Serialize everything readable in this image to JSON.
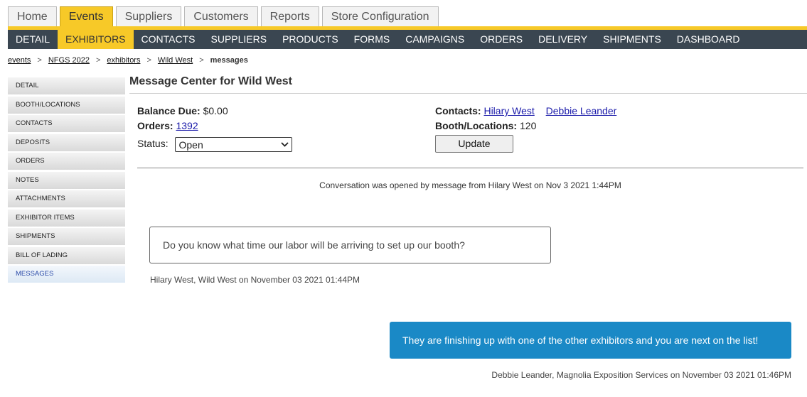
{
  "top_tabs": [
    "Home",
    "Events",
    "Suppliers",
    "Customers",
    "Reports",
    "Store Configuration"
  ],
  "subnav": [
    "DETAIL",
    "EXHIBITORS",
    "CONTACTS",
    "SUPPLIERS",
    "PRODUCTS",
    "FORMS",
    "CAMPAIGNS",
    "ORDERS",
    "DELIVERY",
    "SHIPMENTS",
    "DASHBOARD"
  ],
  "breadcrumb": {
    "events": "events",
    "event": "NFGS 2022",
    "exhibitors": "exhibitors",
    "exhibitor": "Wild West",
    "current": "messages",
    "sep": ">"
  },
  "sidebar": [
    "DETAIL",
    "BOOTH/LOCATIONS",
    "CONTACTS",
    "DEPOSITS",
    "ORDERS",
    "NOTES",
    "ATTACHMENTS",
    "EXHIBITOR ITEMS",
    "SHIPMENTS",
    "BILL OF LADING",
    "MESSAGES"
  ],
  "main": {
    "title": "Message Center for Wild West",
    "balance_label": "Balance Due:",
    "balance_value": "$0.00",
    "orders_label": "Orders:",
    "orders_value": "1392",
    "status_label": "Status:",
    "status_value": "Open",
    "contacts_label": "Contacts:",
    "contact_1": "Hilary West",
    "contact_2": "Debbie Leander",
    "booth_label": "Booth/Locations:",
    "booth_value": "120",
    "update_label": "Update"
  },
  "conversation": {
    "opened_text": "Conversation was opened by message from Hilary West on Nov 3 2021 1:44PM",
    "messages": [
      {
        "text": "Do you know what time our labor will be arriving to set up our booth?",
        "meta": "Hilary West, Wild West on November 03 2021 01:44PM"
      },
      {
        "text": "They are finishing up with one of the other exhibitors and you are next on the list!",
        "meta": "Debbie Leander, Magnolia Exposition Services on November 03 2021 01:46PM"
      }
    ]
  },
  "colors": {
    "accent": "#f7c928",
    "nav_bg": "#3a4651",
    "outgoing_bubble": "#1a89c6"
  }
}
